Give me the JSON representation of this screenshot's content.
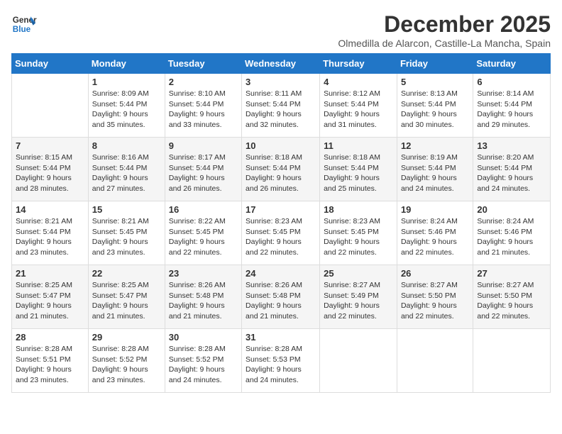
{
  "header": {
    "logo_line1": "General",
    "logo_line2": "Blue",
    "month": "December 2025",
    "location": "Olmedilla de Alarcon, Castille-La Mancha, Spain"
  },
  "weekdays": [
    "Sunday",
    "Monday",
    "Tuesday",
    "Wednesday",
    "Thursday",
    "Friday",
    "Saturday"
  ],
  "weeks": [
    [
      {
        "day": "",
        "info": ""
      },
      {
        "day": "1",
        "info": "Sunrise: 8:09 AM\nSunset: 5:44 PM\nDaylight: 9 hours\nand 35 minutes."
      },
      {
        "day": "2",
        "info": "Sunrise: 8:10 AM\nSunset: 5:44 PM\nDaylight: 9 hours\nand 33 minutes."
      },
      {
        "day": "3",
        "info": "Sunrise: 8:11 AM\nSunset: 5:44 PM\nDaylight: 9 hours\nand 32 minutes."
      },
      {
        "day": "4",
        "info": "Sunrise: 8:12 AM\nSunset: 5:44 PM\nDaylight: 9 hours\nand 31 minutes."
      },
      {
        "day": "5",
        "info": "Sunrise: 8:13 AM\nSunset: 5:44 PM\nDaylight: 9 hours\nand 30 minutes."
      },
      {
        "day": "6",
        "info": "Sunrise: 8:14 AM\nSunset: 5:44 PM\nDaylight: 9 hours\nand 29 minutes."
      }
    ],
    [
      {
        "day": "7",
        "info": "Sunrise: 8:15 AM\nSunset: 5:44 PM\nDaylight: 9 hours\nand 28 minutes."
      },
      {
        "day": "8",
        "info": "Sunrise: 8:16 AM\nSunset: 5:44 PM\nDaylight: 9 hours\nand 27 minutes."
      },
      {
        "day": "9",
        "info": "Sunrise: 8:17 AM\nSunset: 5:44 PM\nDaylight: 9 hours\nand 26 minutes."
      },
      {
        "day": "10",
        "info": "Sunrise: 8:18 AM\nSunset: 5:44 PM\nDaylight: 9 hours\nand 26 minutes."
      },
      {
        "day": "11",
        "info": "Sunrise: 8:18 AM\nSunset: 5:44 PM\nDaylight: 9 hours\nand 25 minutes."
      },
      {
        "day": "12",
        "info": "Sunrise: 8:19 AM\nSunset: 5:44 PM\nDaylight: 9 hours\nand 24 minutes."
      },
      {
        "day": "13",
        "info": "Sunrise: 8:20 AM\nSunset: 5:44 PM\nDaylight: 9 hours\nand 24 minutes."
      }
    ],
    [
      {
        "day": "14",
        "info": "Sunrise: 8:21 AM\nSunset: 5:44 PM\nDaylight: 9 hours\nand 23 minutes."
      },
      {
        "day": "15",
        "info": "Sunrise: 8:21 AM\nSunset: 5:45 PM\nDaylight: 9 hours\nand 23 minutes."
      },
      {
        "day": "16",
        "info": "Sunrise: 8:22 AM\nSunset: 5:45 PM\nDaylight: 9 hours\nand 22 minutes."
      },
      {
        "day": "17",
        "info": "Sunrise: 8:23 AM\nSunset: 5:45 PM\nDaylight: 9 hours\nand 22 minutes."
      },
      {
        "day": "18",
        "info": "Sunrise: 8:23 AM\nSunset: 5:45 PM\nDaylight: 9 hours\nand 22 minutes."
      },
      {
        "day": "19",
        "info": "Sunrise: 8:24 AM\nSunset: 5:46 PM\nDaylight: 9 hours\nand 22 minutes."
      },
      {
        "day": "20",
        "info": "Sunrise: 8:24 AM\nSunset: 5:46 PM\nDaylight: 9 hours\nand 21 minutes."
      }
    ],
    [
      {
        "day": "21",
        "info": "Sunrise: 8:25 AM\nSunset: 5:47 PM\nDaylight: 9 hours\nand 21 minutes."
      },
      {
        "day": "22",
        "info": "Sunrise: 8:25 AM\nSunset: 5:47 PM\nDaylight: 9 hours\nand 21 minutes."
      },
      {
        "day": "23",
        "info": "Sunrise: 8:26 AM\nSunset: 5:48 PM\nDaylight: 9 hours\nand 21 minutes."
      },
      {
        "day": "24",
        "info": "Sunrise: 8:26 AM\nSunset: 5:48 PM\nDaylight: 9 hours\nand 21 minutes."
      },
      {
        "day": "25",
        "info": "Sunrise: 8:27 AM\nSunset: 5:49 PM\nDaylight: 9 hours\nand 22 minutes."
      },
      {
        "day": "26",
        "info": "Sunrise: 8:27 AM\nSunset: 5:50 PM\nDaylight: 9 hours\nand 22 minutes."
      },
      {
        "day": "27",
        "info": "Sunrise: 8:27 AM\nSunset: 5:50 PM\nDaylight: 9 hours\nand 22 minutes."
      }
    ],
    [
      {
        "day": "28",
        "info": "Sunrise: 8:28 AM\nSunset: 5:51 PM\nDaylight: 9 hours\nand 23 minutes."
      },
      {
        "day": "29",
        "info": "Sunrise: 8:28 AM\nSunset: 5:52 PM\nDaylight: 9 hours\nand 23 minutes."
      },
      {
        "day": "30",
        "info": "Sunrise: 8:28 AM\nSunset: 5:52 PM\nDaylight: 9 hours\nand 24 minutes."
      },
      {
        "day": "31",
        "info": "Sunrise: 8:28 AM\nSunset: 5:53 PM\nDaylight: 9 hours\nand 24 minutes."
      },
      {
        "day": "",
        "info": ""
      },
      {
        "day": "",
        "info": ""
      },
      {
        "day": "",
        "info": ""
      }
    ]
  ]
}
